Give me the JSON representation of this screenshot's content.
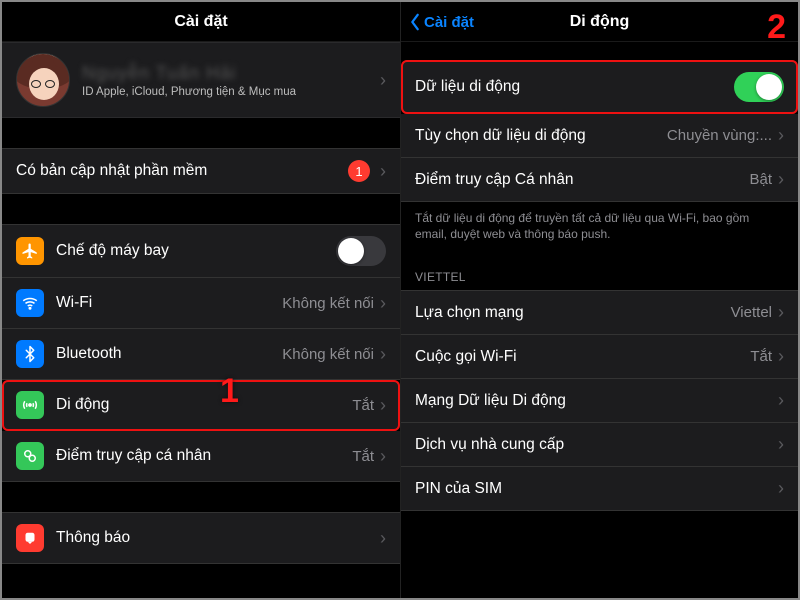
{
  "left": {
    "title": "Cài đặt",
    "profile": {
      "name": "Nguyễn Tuấn Hải",
      "subtitle": "ID Apple, iCloud, Phương tiện & Mục mua"
    },
    "update_row": {
      "label": "Có bản cập nhật phần mềm",
      "badge": "1"
    },
    "rows": {
      "airplane": {
        "label": "Chế độ máy bay"
      },
      "wifi": {
        "label": "Wi-Fi",
        "value": "Không kết nối"
      },
      "bluetooth": {
        "label": "Bluetooth",
        "value": "Không kết nối"
      },
      "cellular": {
        "label": "Di động",
        "value": "Tắt"
      },
      "hotspot": {
        "label": "Điểm truy cập cá nhân",
        "value": "Tắt"
      },
      "notifications": {
        "label": "Thông báo"
      }
    },
    "step": "1"
  },
  "right": {
    "back": "Cài đặt",
    "title": "Di động",
    "rows": {
      "cellular_data": {
        "label": "Dữ liệu di động"
      },
      "options": {
        "label": "Tùy chọn dữ liệu di động",
        "value": "Chuyền vùng:..."
      },
      "hotspot": {
        "label": "Điểm truy cập Cá nhân",
        "value": "Bật"
      }
    },
    "hint": "Tắt dữ liệu di động để truyền tất cả dữ liệu qua Wi-Fi, bao gồm email, duyệt web và thông báo push.",
    "carrier_section": "VIETTEL",
    "carrier_rows": {
      "network_selection": {
        "label": "Lựa chọn mạng",
        "value": "Viettel"
      },
      "wifi_calling": {
        "label": "Cuộc gọi Wi-Fi",
        "value": "Tắt"
      },
      "cellular_network": {
        "label": "Mạng Dữ liệu Di động"
      },
      "carrier_services": {
        "label": "Dịch vụ nhà cung cấp"
      },
      "sim_pin": {
        "label": "PIN của SIM"
      }
    },
    "step": "2"
  }
}
